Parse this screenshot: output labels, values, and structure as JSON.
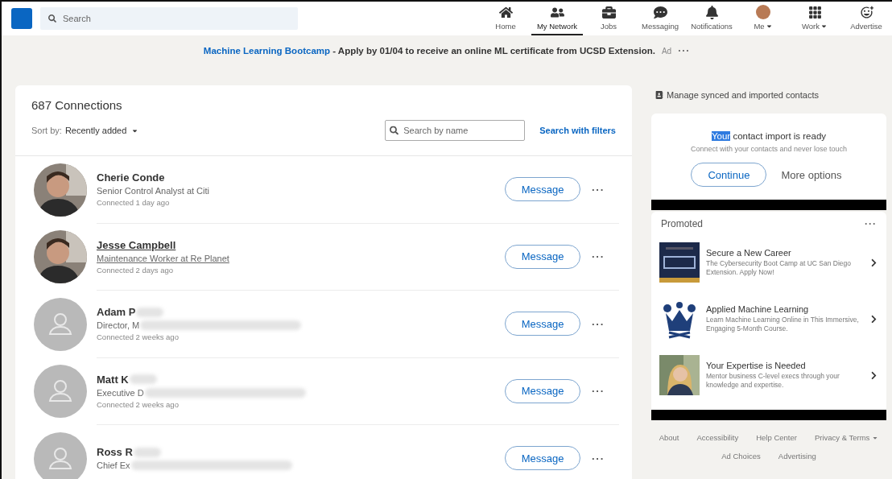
{
  "nav": {
    "search": {
      "placeholder": "Search"
    },
    "items": [
      {
        "label": "Home",
        "selected": false,
        "dropdown": false
      },
      {
        "label": "My Network",
        "selected": true,
        "dropdown": false
      },
      {
        "label": "Jobs",
        "selected": false,
        "dropdown": false
      },
      {
        "label": "Messaging",
        "selected": false,
        "dropdown": false
      },
      {
        "label": "Notifications",
        "selected": false,
        "dropdown": false
      },
      {
        "label": "Me",
        "selected": false,
        "dropdown": true
      },
      {
        "label": "Work",
        "selected": false,
        "dropdown": true
      },
      {
        "label": "Advertise",
        "selected": false,
        "dropdown": false
      }
    ]
  },
  "banner": {
    "link": "Machine Learning Bootcamp",
    "text": " - Apply by 01/04 to receive an online ML certificate from UCSD Extension.",
    "ad_label": "Ad",
    "more": "···"
  },
  "connections": {
    "title": "687 Connections",
    "sort_label": "Sort by:",
    "sort_value": "Recently added",
    "search": {
      "placeholder": "Search by name"
    },
    "filters_link": "Search with filters",
    "rows": [
      {
        "name": "Cherie Conde",
        "name_blurred": false,
        "headline": "Senior Control Analyst at Citi",
        "headline_blurred": false,
        "connected": "Connected 1 day ago",
        "hovered": false,
        "button": "Message",
        "more": "···"
      },
      {
        "name": "Jesse Campbell",
        "name_blurred": false,
        "headline": "Maintenance Worker at Re Planet",
        "headline_blurred": false,
        "connected": "Connected 2 days ago",
        "hovered": true,
        "button": "Message",
        "more": "···"
      },
      {
        "kind": "default",
        "name": "Adam P",
        "name_blurred": true,
        "headline": "Director, M",
        "headline_blurred": true,
        "connected": "Connected 2 weeks ago",
        "hovered": false,
        "button": "Message",
        "more": "···"
      },
      {
        "kind": "default",
        "name": "Matt K",
        "name_blurred": true,
        "headline": "Executive D",
        "headline_blurred": true,
        "connected": "Connected 2 weeks ago",
        "hovered": false,
        "button": "Message",
        "more": "···"
      },
      {
        "kind": "default",
        "name": "Ross R",
        "name_blurred": true,
        "headline": "Chief Ex",
        "headline_blurred": true,
        "hovered": false,
        "button": "Message",
        "more": "···"
      }
    ]
  },
  "sidebar": {
    "manage_link": "Manage synced and imported contacts",
    "import_card": {
      "title_parts": [
        {
          "text": "Your",
          "selected": true
        },
        {
          "text": "contact import is ready",
          "selected": false
        }
      ],
      "subtitle": "Connect with your contacts and never lose touch",
      "primary_button": "Continue",
      "secondary_button": "More options"
    },
    "promoted": {
      "title": "Promoted",
      "more": "···",
      "items": [
        {
          "kind": "logo",
          "title": "Secure a New Career",
          "description": "The Cybersecurity Boot Camp at UC San Diego Extension. Apply Now!"
        },
        {
          "kind": "crest",
          "title": "Applied Machine Learning",
          "description": "Learn Machine Learning Online in This Immersive, Engaging 5-Month Course."
        },
        {
          "title": "Your Expertise is Needed",
          "description": "Mentor business C-level execs through your knowledge and expertise."
        }
      ]
    },
    "footer": [
      {
        "label": "About",
        "dropdown": false
      },
      {
        "label": "Accessibility",
        "dropdown": false
      },
      {
        "label": "Help Center",
        "dropdown": false
      },
      {
        "label": "Privacy & Terms",
        "dropdown": true
      },
      {
        "label": "Ad Choices",
        "dropdown": false
      },
      {
        "label": "Advertising",
        "dropdown": false
      }
    ]
  }
}
